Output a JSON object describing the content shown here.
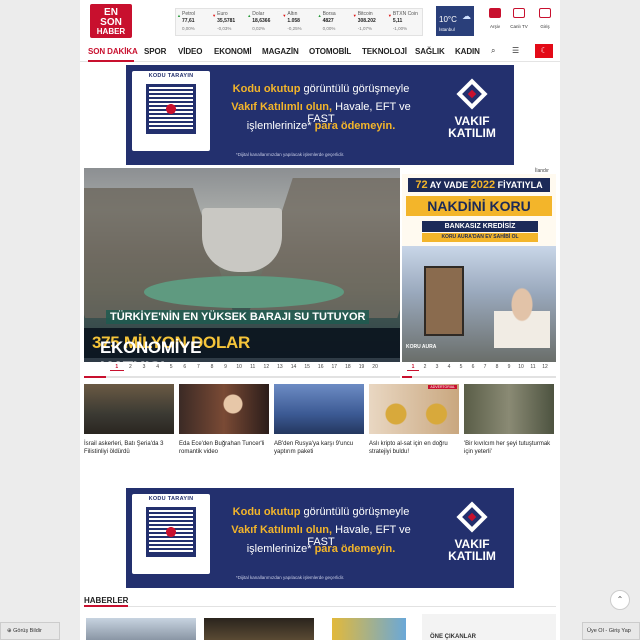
{
  "brand": {
    "logo_lines": [
      "EN",
      "SON",
      "HABER"
    ],
    "accent": "#c8102e",
    "navy": "#23306e"
  },
  "ticker": [
    {
      "name": "Petrol",
      "value": "77,61",
      "change": "0,00%",
      "dir": "up"
    },
    {
      "name": "Euro",
      "value": "35,5781",
      "change": "-0,03%",
      "dir": "dn"
    },
    {
      "name": "Dolar",
      "value": "18,6366",
      "change": "0,02%",
      "dir": "up"
    },
    {
      "name": "Altın",
      "value": "1.058",
      "change": "-0,25%",
      "dir": "dn"
    },
    {
      "name": "Borsa",
      "value": "4827",
      "change": "0,00%",
      "dir": "up"
    },
    {
      "name": "Bitcoin",
      "value": "308.202",
      "change": "-1,07%",
      "dir": "dn"
    },
    {
      "name": "BTXN Coin",
      "value": "5,11",
      "change": "-1,00%",
      "dir": "dn"
    }
  ],
  "weather": {
    "temp": "10°C",
    "city": "İstanbul"
  },
  "header_icons": [
    {
      "label": "Arşiv",
      "icon": "archive-icon"
    },
    {
      "label": "Canlı TV",
      "icon": "tv-icon"
    },
    {
      "label": "Giriş",
      "icon": "login-icon"
    }
  ],
  "nav": {
    "items": [
      "SON DAKİKA",
      "SPOR",
      "VİDEO",
      "EKONOMİ",
      "MAGAZİN",
      "OTOMOBİL",
      "TEKNOLOJİ",
      "SAĞLIK",
      "KADIN"
    ],
    "active": "SON DAKİKA"
  },
  "ad_banner": {
    "kodu": "KODU TARAYIN",
    "line1_a": "Kodu okutup",
    "line1_b": " görüntülü görüşmeyle",
    "line2_a": "Vakıf Katılımlı olun,",
    "line2_b": " Havale, EFT ve FAST",
    "line3_a": "işlemlerinize*",
    "line3_b": " para ödemeyin.",
    "fine": "*Dijital kanallarımızdan yapılacak işlemlerde geçerlidir.",
    "brand1": "VAKIF",
    "brand2": "KATILIM"
  },
  "hero": {
    "caption1": "TÜRKİYE'NİN EN YÜKSEK BARAJI SU TUTUYOR",
    "caption2_a": "EKONOMİYE KATKISI ",
    "caption2_b": "375 MİLYON DOLAR",
    "pages": [
      "1",
      "2",
      "3",
      "4",
      "5",
      "6",
      "7",
      "8",
      "9",
      "10",
      "11",
      "12",
      "13",
      "14",
      "15",
      "16",
      "17",
      "18",
      "19",
      "20"
    ],
    "active_page": 1
  },
  "side_ad": {
    "ilandir": "İlandır",
    "vade_a": "72",
    "vade_b": " AY VADE ",
    "vade_c": "2022",
    "vade_d": " FİYATIYLA",
    "nakdini": "NAKDİNİ KORU",
    "bankasiz": "BANKASIZ  KREDİSİZ",
    "koru": "KORU AURA'DAN EV SAHİBİ OL",
    "brand": "KORU AURA",
    "pages": [
      "1",
      "2",
      "3",
      "4",
      "5",
      "6",
      "7",
      "8",
      "9",
      "10",
      "11",
      "12"
    ],
    "active_page": 1
  },
  "news": [
    {
      "title": "İsrail askerleri, Batı Şeria'da 3 Filistinliyi öldürdü"
    },
    {
      "title": "Eda Ece'den Buğrahan Tuncer'li romantik video"
    },
    {
      "title": "AB'den Rusya'ya karşı 9'uncu yaptırım paketi"
    },
    {
      "title": "Aslı kripto al-sat için en doğru stratejiyi buldu!",
      "badge": "ADVERTORIAL"
    },
    {
      "title": "'Bir kıvılcım her şeyi tutuşturmak için yeterli'"
    }
  ],
  "section_title": "HABERLER",
  "one_cikanlar": "ÖNE ÇIKANLAR",
  "footer": {
    "feedback": "Görüş Bildir",
    "login": "Üye Ol - Giriş Yap"
  }
}
